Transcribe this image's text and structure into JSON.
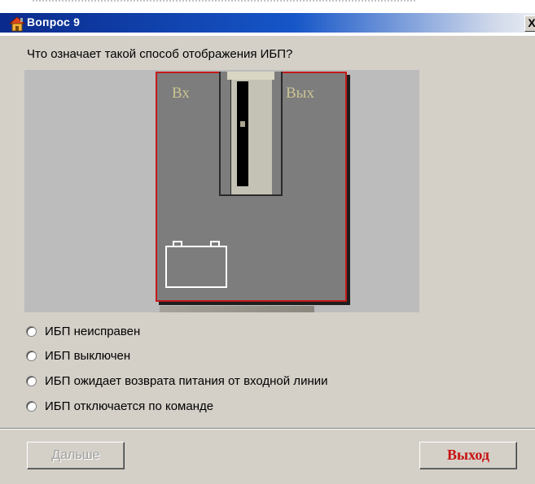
{
  "window": {
    "title": "Вопрос  9",
    "close_label": "X"
  },
  "question": "Что означает такой способ отображения ИБП?",
  "picture": {
    "label_in": "Вх",
    "label_out": "Вых"
  },
  "options": [
    {
      "label": "ИБП неисправен",
      "selected": false
    },
    {
      "label": "ИБП выключен",
      "selected": false
    },
    {
      "label": "ИБП ожидает возврата питания от входной линии",
      "selected": false
    },
    {
      "label": "ИБП отключается по команде",
      "selected": false
    }
  ],
  "buttons": {
    "next_label": "Дальше",
    "next_enabled": false,
    "exit_label": "Выход"
  },
  "colors": {
    "title_bar": "#0a2a8c",
    "window_bg": "#d4d0c8",
    "panel_border": "#c51a1a",
    "exit_text": "#c81010"
  }
}
